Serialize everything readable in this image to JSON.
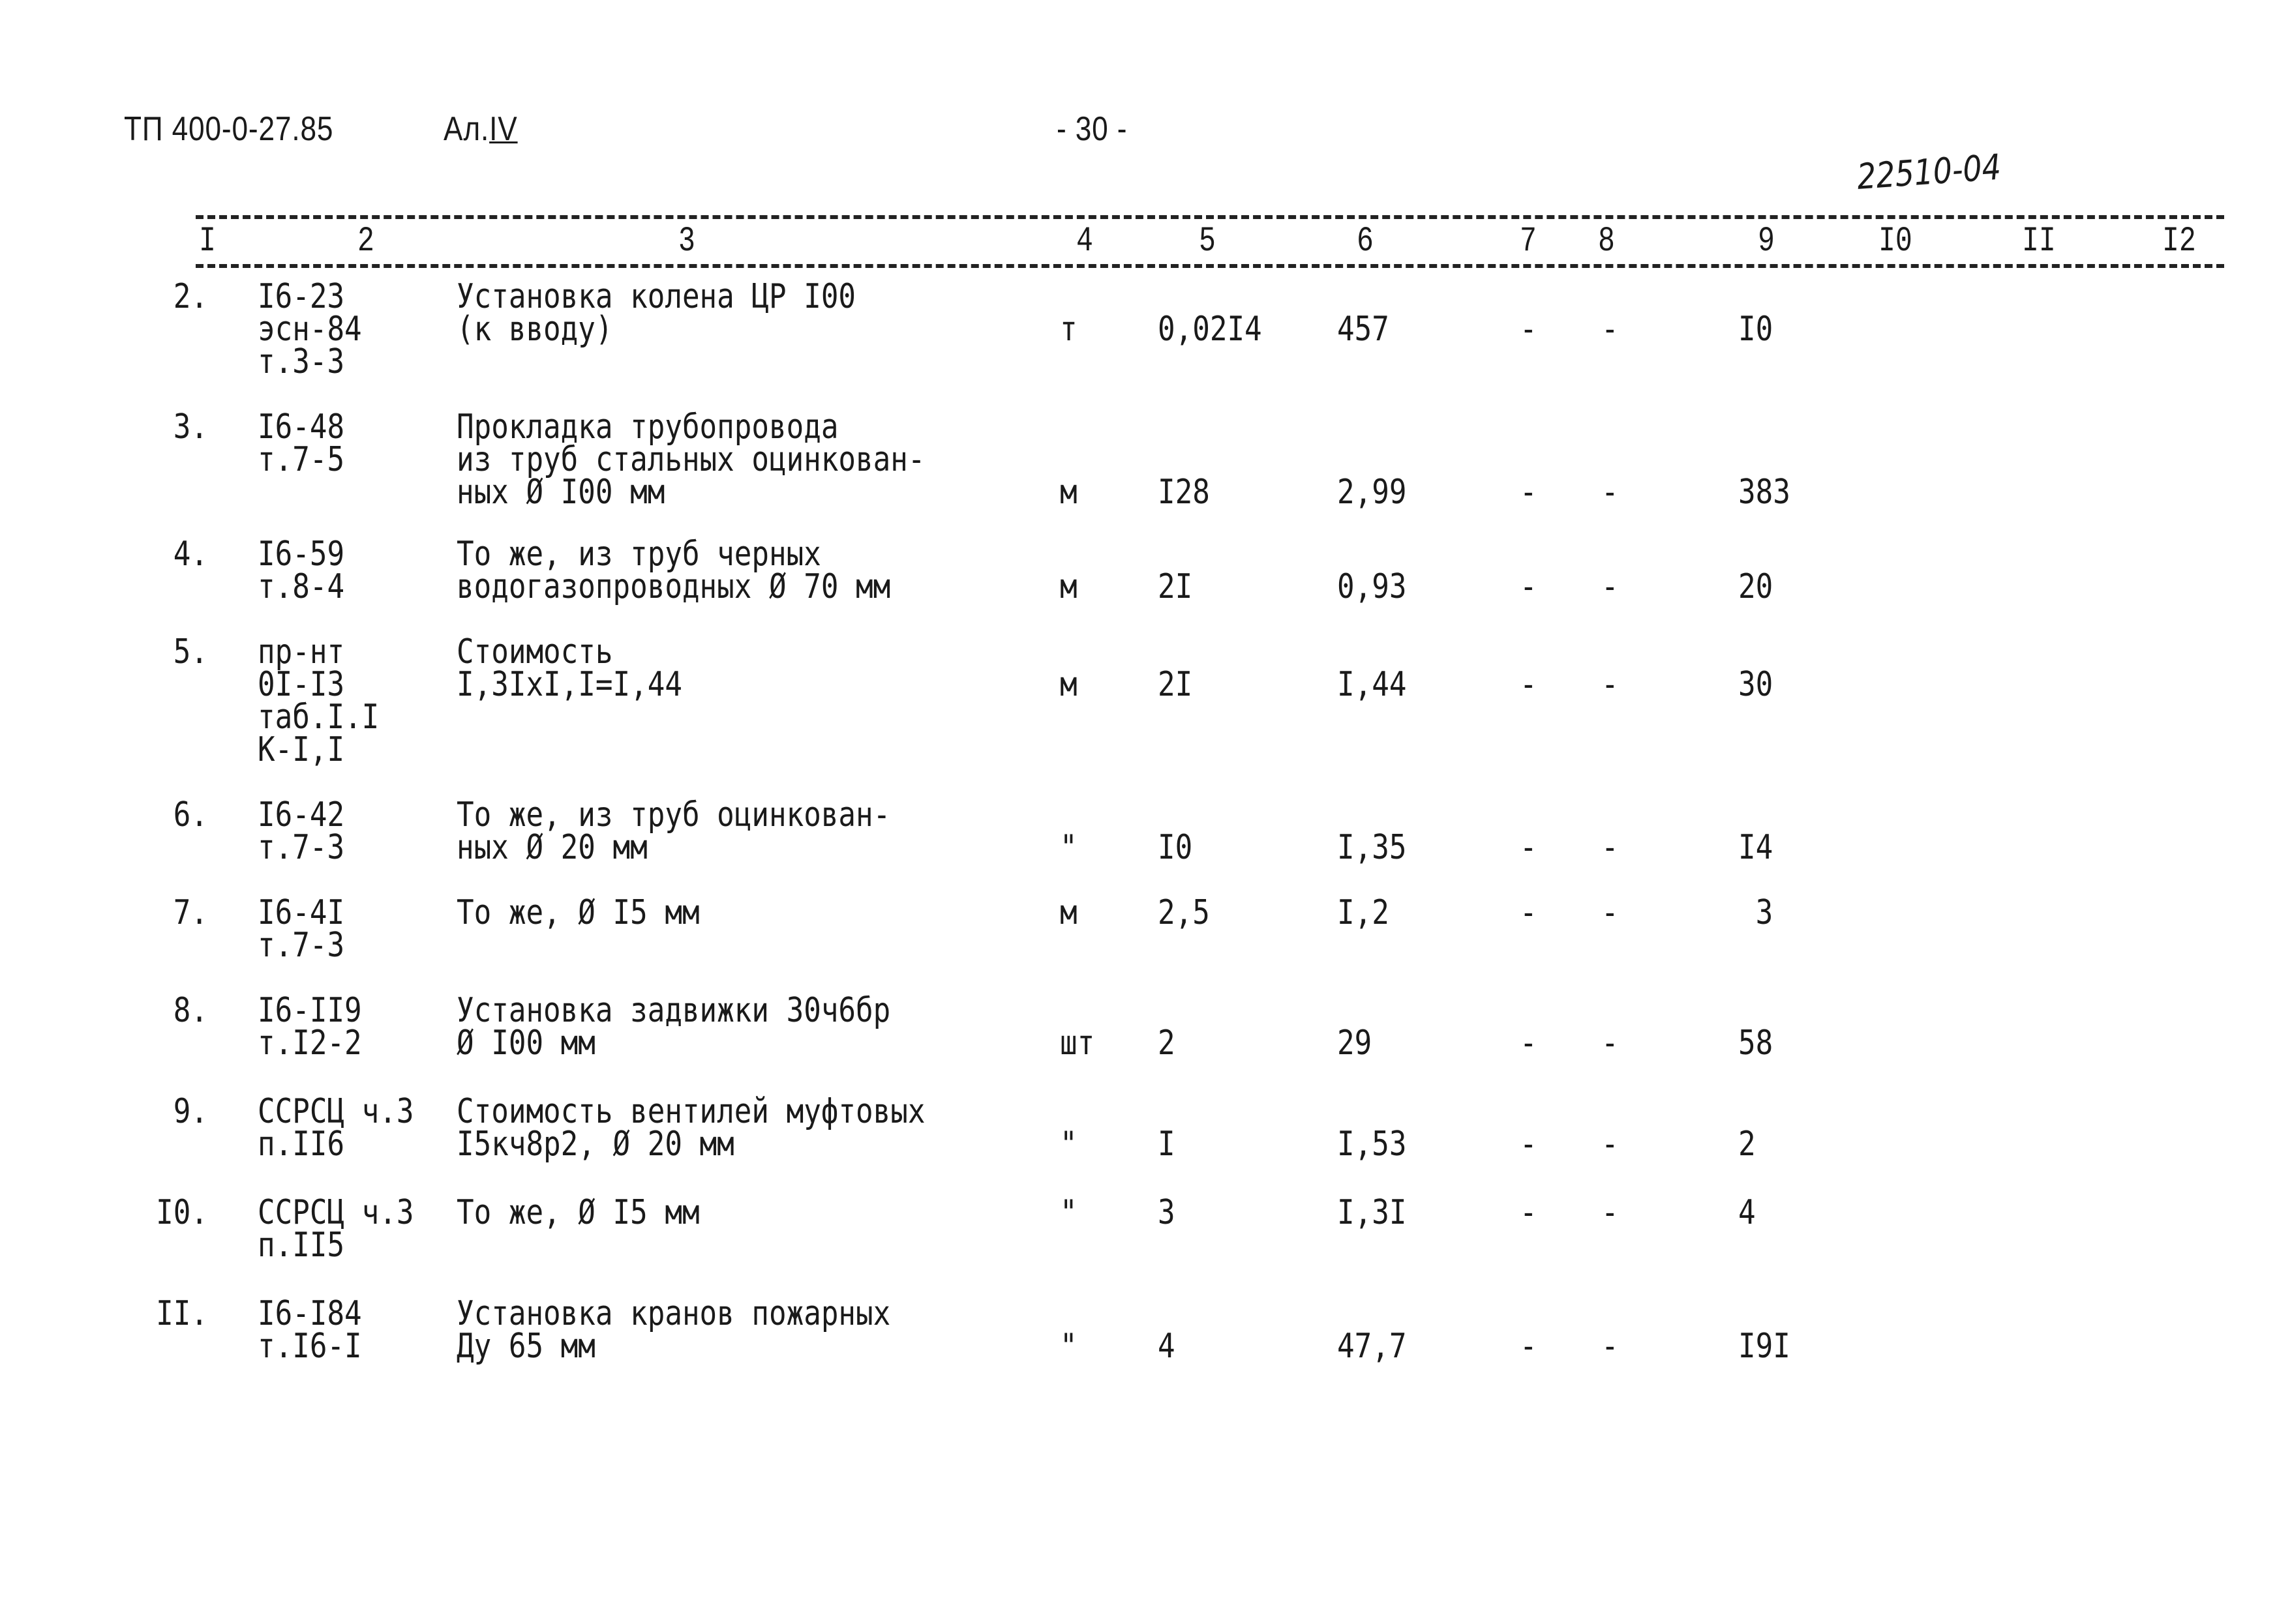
{
  "header": {
    "doc_code": "ТП 400-0-27.85",
    "sheet_label": "Ал.",
    "sheet_roman": "IV",
    "page_number": "- 30 -",
    "handwritten_number": "22510-04"
  },
  "columns": [
    "I",
    "2",
    "3",
    "4",
    "5",
    "6",
    "7",
    "8",
    "9",
    "I0",
    "II",
    "I2"
  ],
  "rows": [
    {
      "no": "2.",
      "code": [
        "I6-23",
        "эсн-84",
        "т.3-3"
      ],
      "desc": [
        "Установка колена ЦР I00",
        "(к вводу)"
      ],
      "unit": "т",
      "qty": "0,02I4",
      "price": "457",
      "c7": "-",
      "c8": "-",
      "total": "I0",
      "value_line": 1
    },
    {
      "no": "3.",
      "code": [
        "I6-48",
        "т.7-5"
      ],
      "desc": [
        "Прокладка трубопровода",
        "из труб стальных оцинкован-",
        "ных Ø I00 мм"
      ],
      "unit": "м",
      "qty": "I28",
      "price": "2,99",
      "c7": "-",
      "c8": "-",
      "total": "383",
      "value_line": 2
    },
    {
      "no": "4.",
      "code": [
        "I6-59",
        "т.8-4"
      ],
      "desc": [
        "То же, из труб черных",
        "водогазопроводных Ø 70 мм"
      ],
      "unit": "м",
      "qty": "2I",
      "price": "0,93",
      "c7": "-",
      "c8": "-",
      "total": "20",
      "value_line": 1
    },
    {
      "no": "5.",
      "code": [
        "пр-нт",
        "0I-I3",
        "таб.I.I",
        "К-I,I"
      ],
      "desc": [
        "Стоимость",
        "I,3IхI,I=I,44"
      ],
      "unit": "м",
      "qty": "2I",
      "price": "I,44",
      "c7": "-",
      "c8": "-",
      "total": "30",
      "value_line": 1
    },
    {
      "no": "6.",
      "code": [
        "I6-42",
        "т.7-3"
      ],
      "desc": [
        "То же, из труб оцинкован-",
        "ных Ø 20 мм"
      ],
      "unit": "\"",
      "qty": "I0",
      "price": "I,35",
      "c7": "-",
      "c8": "-",
      "total": "I4",
      "value_line": 1
    },
    {
      "no": "7.",
      "code": [
        "I6-4I",
        "т.7-3"
      ],
      "desc": [
        "То же, Ø I5 мм"
      ],
      "unit": "м",
      "qty": "2,5",
      "price": "I,2",
      "c7": "-",
      "c8": "-",
      "total": " 3",
      "value_line": 0
    },
    {
      "no": "8.",
      "code": [
        "I6-II9",
        "т.I2-2"
      ],
      "desc": [
        "Установка задвижки 30ч6бр",
        "Ø I00 мм"
      ],
      "unit": "шт",
      "qty": "2",
      "price": "29",
      "c7": "-",
      "c8": "-",
      "total": "58",
      "value_line": 1
    },
    {
      "no": "9.",
      "code": [
        "ССРСЦ ч.3",
        "п.II6"
      ],
      "desc": [
        "Стоимость вентилей муфтовых",
        "I5кч8р2, Ø 20 мм"
      ],
      "unit": "\"",
      "qty": "I",
      "price": "I,53",
      "c7": "-",
      "c8": "-",
      "total": "2",
      "value_line": 1
    },
    {
      "no": "I0.",
      "code": [
        "ССРСЦ ч.3",
        "п.II5"
      ],
      "desc": [
        "То же, Ø I5 мм"
      ],
      "unit": "\"",
      "qty": "3",
      "price": "I,3I",
      "c7": "-",
      "c8": "-",
      "total": "4",
      "value_line": 0
    },
    {
      "no": "II.",
      "code": [
        "I6-I84",
        "т.I6-I"
      ],
      "desc": [
        "Установка кранов пожарных",
        "Ду 65 мм"
      ],
      "unit": "\"",
      "qty": "4",
      "price": "47,7",
      "c7": "-",
      "c8": "-",
      "total": "I9I",
      "value_line": 1
    }
  ]
}
